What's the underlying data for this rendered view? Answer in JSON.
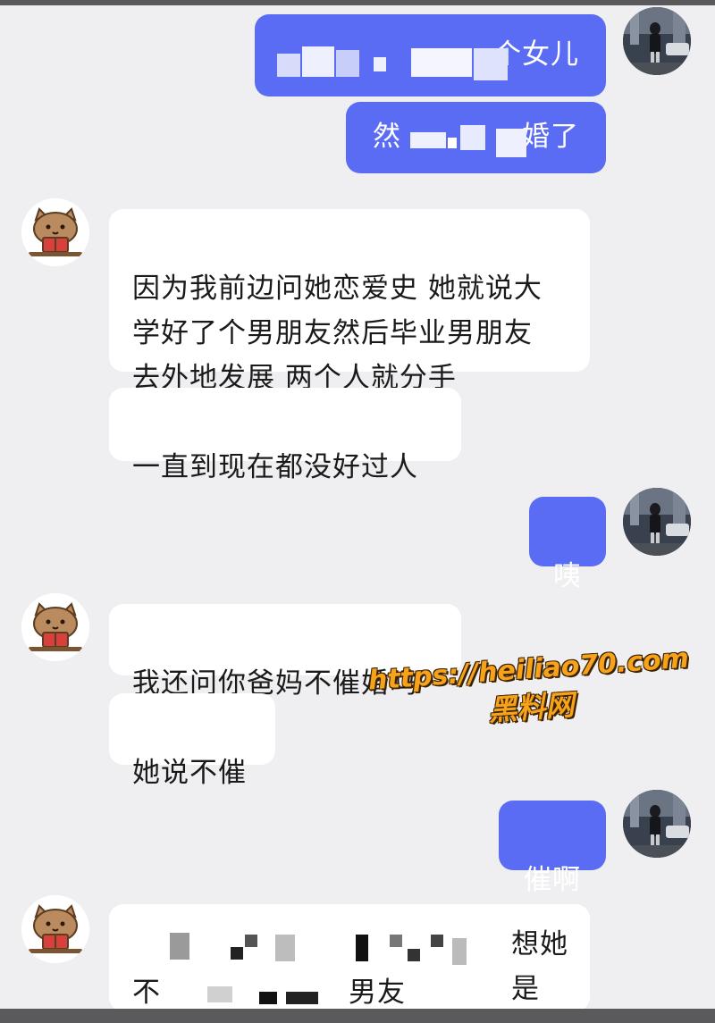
{
  "messages": [
    {
      "side": "out",
      "text": "个女儿",
      "note_redacted": true
    },
    {
      "side": "out",
      "text_start": "然",
      "text_end": "婚了",
      "note_redacted": true
    },
    {
      "side": "in",
      "text": "因为我前边问她恋爱史 她就说大\n学好了个男朋友然后毕业男朋友\n去外地发展 两个人就分手"
    },
    {
      "side": "in",
      "text": "一直到现在都没好过人"
    },
    {
      "side": "out",
      "text": "咦"
    },
    {
      "side": "in",
      "text": "我还问你爸妈不催婚吗"
    },
    {
      "side": "in",
      "text": "她说不催"
    },
    {
      "side": "out",
      "text": "催啊"
    },
    {
      "side": "in",
      "text_line1_end": "想她是",
      "text_line2_start": "不",
      "text_line2_end": "男友",
      "note_redacted": true
    }
  ],
  "watermark": {
    "url": "https://heiliao70.com",
    "site": "黑料网",
    "color": "#f6a21a"
  },
  "colors": {
    "background": "#efeff1",
    "outgoing_bubble": "#5a6cf4",
    "incoming_bubble": "#ffffff"
  },
  "avatars": {
    "self": "person-photo-avatar",
    "friend": "cartoon-cat-reading-avatar"
  }
}
